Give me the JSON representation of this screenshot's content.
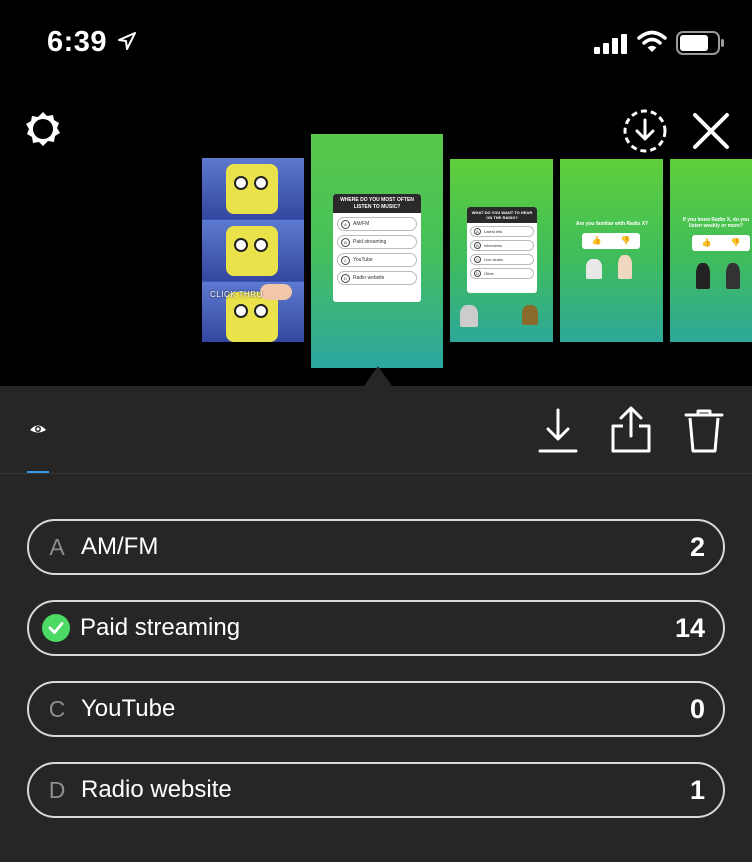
{
  "status_bar": {
    "time": "6:39"
  },
  "thumbnails": {
    "sponge_caption": "CLICK THRU",
    "active": {
      "question": "WHERE DO YOU MOST OFTEN LISTEN TO MUSIC?",
      "options": [
        {
          "letter": "A",
          "label": "AM/FM"
        },
        {
          "letter": "B",
          "label": "Paid streaming"
        },
        {
          "letter": "C",
          "label": "YouTube"
        },
        {
          "letter": "D",
          "label": "Radio website"
        }
      ]
    },
    "third": {
      "question": "WHAT DO YOU WANT TO HEAR ON THE RADIO?",
      "options": [
        {
          "letter": "A",
          "label": "Latest hits"
        },
        {
          "letter": "B",
          "label": "Interviews"
        },
        {
          "letter": "C",
          "label": "Live studio"
        },
        {
          "letter": "D",
          "label": "Other"
        }
      ]
    },
    "fourth": {
      "question": "Are you familiar with Radio X?"
    },
    "fifth": {
      "question": "If you knew Radio X, do you listen weekly or more?"
    }
  },
  "poll_results": [
    {
      "letter": "A",
      "label": "AM/FM",
      "count": "2",
      "correct": false
    },
    {
      "letter": "B",
      "label": "Paid streaming",
      "count": "14",
      "correct": true
    },
    {
      "letter": "C",
      "label": "YouTube",
      "count": "0",
      "correct": false
    },
    {
      "letter": "D",
      "label": "Radio website",
      "count": "1",
      "correct": false
    }
  ],
  "colors": {
    "accent_green": "#4cd964",
    "tab_underline": "#3897f0"
  }
}
